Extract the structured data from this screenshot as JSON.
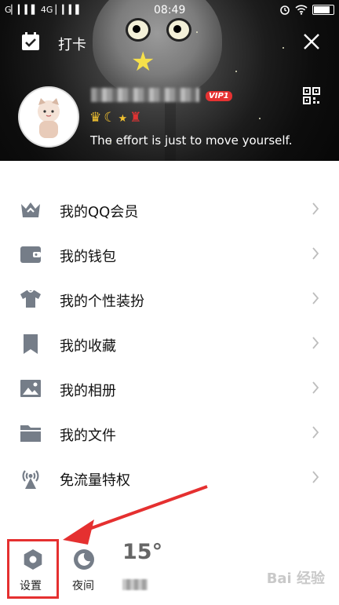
{
  "status_bar": {
    "carrier": "G▏▎▍▌ 4G ▏▎▍▌",
    "time": "08:49"
  },
  "header": {
    "checkin_label": "打卡",
    "vip_badge": "VIP1",
    "signature": "The effort is just to move yourself."
  },
  "menu": {
    "items": [
      {
        "label": "我的QQ会员",
        "icon": "crown-icon"
      },
      {
        "label": "我的钱包",
        "icon": "wallet-icon"
      },
      {
        "label": "我的个性装扮",
        "icon": "shirt-icon"
      },
      {
        "label": "我的收藏",
        "icon": "bookmark-icon"
      },
      {
        "label": "我的相册",
        "icon": "photo-icon"
      },
      {
        "label": "我的文件",
        "icon": "folder-icon"
      },
      {
        "label": "免流量特权",
        "icon": "antenna-icon"
      }
    ]
  },
  "bottom": {
    "settings_label": "设置",
    "night_label": "夜间",
    "temperature": "15°"
  },
  "watermark": "Bai 经验",
  "colors": {
    "icon_gray": "#757d88",
    "highlight_red": "#e53030",
    "vip_red": "#e63232"
  }
}
